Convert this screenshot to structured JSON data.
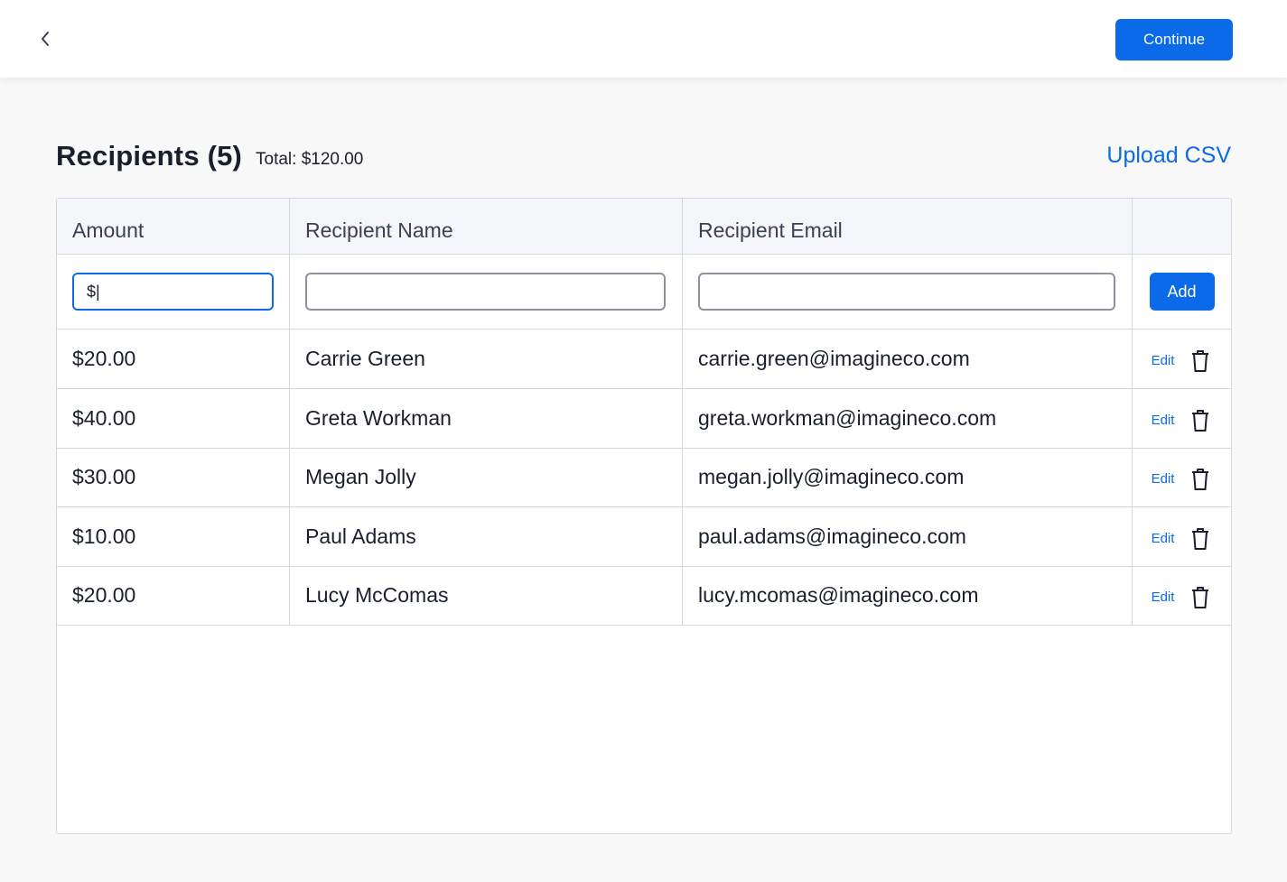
{
  "header": {
    "back_icon": "chevron-left-icon",
    "continue_label": "Continue"
  },
  "recipients": {
    "heading": "Recipients (5)",
    "total": "Total: $120.00",
    "upload_label": "Upload CSV"
  },
  "table": {
    "columns": [
      "Amount",
      "Recipient Name",
      "Recipient Email",
      ""
    ],
    "new_entry": {
      "amount_value": "$|",
      "name_value": "",
      "email_value": "",
      "add_label": "Add"
    },
    "rows": [
      {
        "amount": "$20.00",
        "name": "Carrie Green",
        "email": "carrie.green@imagineco.com",
        "edit": "Edit"
      },
      {
        "amount": "$40.00",
        "name": "Greta Workman",
        "email": "greta.workman@imagineco.com",
        "edit": "Edit"
      },
      {
        "amount": "$30.00",
        "name": "Megan Jolly",
        "email": "megan.jolly@imagineco.com",
        "edit": "Edit"
      },
      {
        "amount": "$10.00",
        "name": "Paul Adams",
        "email": "paul.adams@imagineco.com",
        "edit": "Edit"
      },
      {
        "amount": "$20.00",
        "name": "Lucy McComas",
        "email": "lucy.mcomas@imagineco.com",
        "edit": "Edit"
      }
    ]
  },
  "colors": {
    "accent": "#0b6ae8",
    "border": "#d5d8de",
    "header_bg": "#f4f6f9",
    "page_bg": "#f8f8f8"
  }
}
